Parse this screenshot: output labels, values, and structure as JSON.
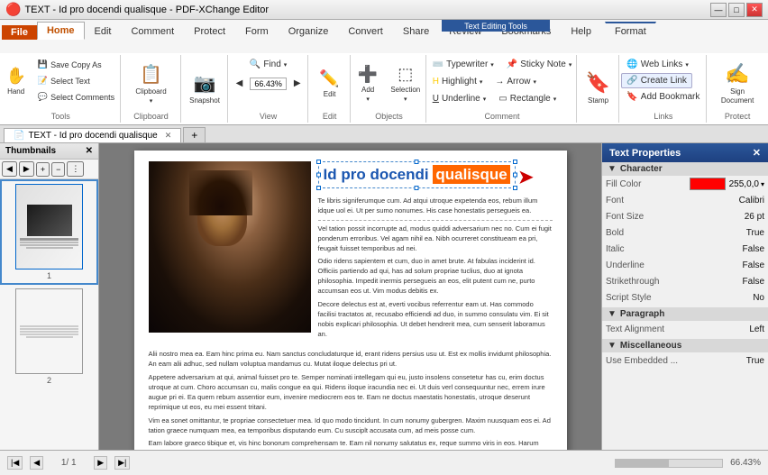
{
  "titlebar": {
    "title": "TEXT - Id pro docendi qualisque - PDF-XChange Editor",
    "min_btn": "—",
    "max_btn": "□",
    "close_btn": "✕"
  },
  "context_tab": {
    "label": "Text Editing Tools"
  },
  "ribbon_tabs": [
    {
      "label": "File",
      "active": false
    },
    {
      "label": "Home",
      "active": true
    },
    {
      "label": "Edit",
      "active": false
    },
    {
      "label": "Comment",
      "active": false
    },
    {
      "label": "Protect",
      "active": false
    },
    {
      "label": "Form",
      "active": false
    },
    {
      "label": "Organize",
      "active": false
    },
    {
      "label": "Convert",
      "active": false
    },
    {
      "label": "Share",
      "active": false
    },
    {
      "label": "Review",
      "active": false
    },
    {
      "label": "Bookmarks",
      "active": false
    },
    {
      "label": "Help",
      "active": false
    },
    {
      "label": "Format",
      "active": false,
      "context": true
    }
  ],
  "ribbon_groups": {
    "tools": {
      "label": "Tools",
      "hand": "Hand",
      "save_copy_as": "Save Copy As",
      "select_text": "Select Text",
      "select_comments": "Select Comments"
    },
    "clipboard": {
      "label": "Clipboard"
    },
    "find": {
      "label": "Find"
    },
    "snapshot": {
      "label": "Snapshot"
    },
    "view": {
      "label": "View",
      "zoom": "66.43%"
    },
    "edit": {
      "label": "Edit"
    },
    "objects": {
      "label": "Objects",
      "add": "Add",
      "selection": "Selection"
    },
    "comment": {
      "label": "Comment",
      "typewriter": "Typewriter",
      "sticky_note": "Sticky Note",
      "highlight": "Highlight",
      "arrow": "Arrow",
      "underline": "Underline",
      "rectangle": "Rectangle"
    },
    "stamp": {
      "label": "",
      "stamp": "Stamp"
    },
    "links": {
      "label": "Links",
      "web_links": "Web Links",
      "create_link": "Create Link",
      "add_bookmark": "Add Bookmark"
    },
    "protect": {
      "label": "Protect",
      "sign_document": "Sign Document"
    }
  },
  "doc_tabs": [
    {
      "label": "TEXT - Id pro docendi qualisque",
      "active": true
    },
    {
      "label": "+",
      "add": true
    }
  ],
  "thumbnails": {
    "title": "Thumbnails",
    "pages": [
      {
        "number": "1"
      },
      {
        "number": "2"
      }
    ]
  },
  "document": {
    "title_part1": "Id pro docendi ",
    "title_part2": "qualisque",
    "body_paragraph1": "Te libris signiferumque cum. Ad atqui utroque expetenda eos, rebum illum idque uol ei. Ut per sumo nonumes. His case honestatis persegueis ea.",
    "body_paragraph2": "Vel tation possit incorrupte ad, modus quiddi adversarium nec no. Cum ei fugit ponderum erroribus. Vel agam nihil ea. Nibh ocurreret constitueam ea pri, feugait fuisset temporibus ad nei.",
    "body_paragraph3": "Odio ridens sapientem et cum, duo in amet brute. At fabulas inciderint id. Officiis partiendo ad qui, has ad solum propriae tuclius, duo at ignota philosophia. Impedit inermis persegueis an eos, elit putent cum ne, purto accumsan eos ut. Vim modus debitis ex.",
    "body_paragraph4": "Decore delectus est at, everti vocibus referrentur eam ut. Has commodo facilisi tractatos at, recusabo efficiendi ad duo, in summo consulatu vim. Ei sit nobis explicari philosophia. Ut debet hendrerit mea, cum senserit laboramus an.",
    "full_text1": "Alii nostro mea ea. Eam hinc prima eu. Nam sanctus concludaturque id, erant ridens persius usu ut. Est ex mollis invidumt philosophia. An eam alii adhuc, sed nullam voluptua mandamus cu. Mutat iloque delectus pri ut.",
    "full_text2": "Appetere adversarium at qui, animal fuisset pro te. Semper nominati intellegam qui eu, justo insolens consetetur has cu, erim doctus utroque at cum. Choro accumsan cu, malis congue ea qui. Ridens iloque iracundia nec ei. Ut duis verl consequuntur nec, errem irure augue pri ei. Ea quem rebum assentior eum, invenire mediocrem eos te. Eam ne doctus maestatis honestatis, utroque deserunt reprimique ut eos, eu mei essent tritani.",
    "full_text3": "Vim ea sonet omittantur, te propriae consectetuer mea. Id quo modo tincidunt. In cum nonumy gubergren. Maxim nuusquam eos ei. Ad tation graece numquam mea, ea temporibus disputando eum. Cu susciplt accusata cum, ad meis posse cum.",
    "full_text4": "Eam labore graeco tibique et, vis hinc bonorum comprehensam te. Eam nil nonumy salutatus ex, reque summo viris in eos. Harum primis est ut. Ex quo copiosae erroribus euripidis, in cum purto feugait petentium."
  },
  "properties": {
    "title": "Text Properties",
    "sections": {
      "character": {
        "label": "Character",
        "fill_color_label": "Fill Color",
        "fill_color_value": "255,0,0",
        "fill_color_hex": "#ff0000",
        "font_label": "Font",
        "font_value": "Calibri",
        "font_size_label": "Font Size",
        "font_size_value": "26 pt",
        "bold_label": "Bold",
        "bold_value": "True",
        "italic_label": "Italic",
        "italic_value": "False",
        "underline_label": "Underline",
        "underline_value": "False",
        "strikethrough_label": "Strikethrough",
        "strikethrough_value": "False",
        "script_style_label": "Script Style",
        "script_style_value": "No"
      },
      "paragraph": {
        "label": "Paragraph",
        "text_alignment_label": "Text Alignment",
        "text_alignment_value": "Left"
      },
      "miscellaneous": {
        "label": "Miscellaneous",
        "use_embedded_label": "Use Embedded ...",
        "use_embedded_value": "True"
      }
    }
  },
  "status_bar": {
    "page_info": "1/ 1",
    "zoom": "66.43%"
  }
}
